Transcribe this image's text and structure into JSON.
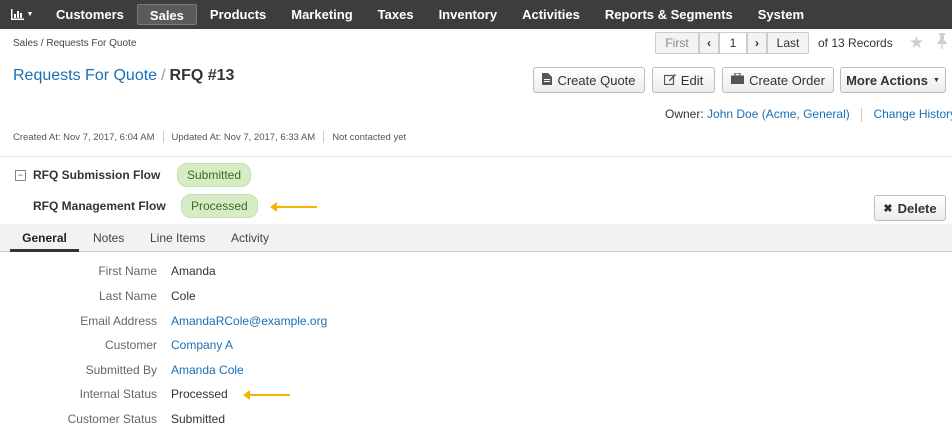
{
  "nav": {
    "items": [
      "Customers",
      "Sales",
      "Products",
      "Marketing",
      "Taxes",
      "Inventory",
      "Activities",
      "Reports & Segments",
      "System"
    ],
    "active": "Sales"
  },
  "breadcrumb": "Sales / Requests For Quote",
  "pager": {
    "first": "First",
    "current": "1",
    "last": "Last",
    "records": "of 13 Records"
  },
  "title": {
    "section": "Requests For Quote",
    "separator": "/",
    "record": "RFQ #13"
  },
  "actions": {
    "create_quote": "Create Quote",
    "edit": "Edit",
    "create_order": "Create Order",
    "more_actions": "More Actions",
    "delete": "Delete"
  },
  "owner": {
    "label": "Owner:",
    "name": "John Doe (Acme, General)",
    "change_history": "Change History"
  },
  "meta": {
    "created": "Created At: Nov 7, 2017, 6:04 AM",
    "updated": "Updated At: Nov 7, 2017, 6:33 AM",
    "contacted": "Not contacted yet"
  },
  "workflows": [
    {
      "name": "RFQ Submission Flow",
      "status": "Submitted"
    },
    {
      "name": "RFQ Management Flow",
      "status": "Processed"
    }
  ],
  "tabs": [
    "General",
    "Notes",
    "Line Items",
    "Activity"
  ],
  "fields": [
    {
      "label": "First Name",
      "value": "Amanda"
    },
    {
      "label": "Last Name",
      "value": "Cole"
    },
    {
      "label": "Email Address",
      "value": "AmandaRCole@example.org"
    },
    {
      "label": "Customer",
      "value": "Company A"
    },
    {
      "label": "Submitted By",
      "value": "Amanda Cole"
    },
    {
      "label": "Internal Status",
      "value": "Processed"
    },
    {
      "label": "Customer Status",
      "value": "Submitted"
    }
  ],
  "colors": {
    "nav_bg": "#3d3d3d",
    "link": "#1a6fb5",
    "badge_bg": "#d5ecc5",
    "annotation_arrow": "#f5b400"
  }
}
